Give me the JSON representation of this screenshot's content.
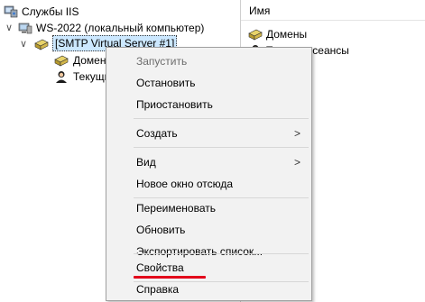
{
  "tree": {
    "root_label": "Службы IIS",
    "server_label": "WS-2022 (локальный компьютер)",
    "smtp_label": "[SMTP Virtual Server #1]",
    "domains_label": "Домены",
    "sessions_label": "Текущие сеансы"
  },
  "list": {
    "column_header": "Имя",
    "items": [
      "Домены",
      "Текущие сеансы"
    ]
  },
  "context_menu": {
    "start": "Запустить",
    "stop": "Остановить",
    "pause": "Приостановить",
    "create": "Создать",
    "view": "Вид",
    "new_window": "Новое окно отсюда",
    "rename": "Переименовать",
    "refresh": "Обновить",
    "export": "Экспортировать список...",
    "properties": "Свойства",
    "help": "Справка",
    "submenu_arrow": ">"
  },
  "tree_chevron": "∨",
  "colors": {
    "selection": "#cce8ff",
    "highlight_underline": "#e3001b",
    "menu_bg": "#f2f2f2"
  }
}
